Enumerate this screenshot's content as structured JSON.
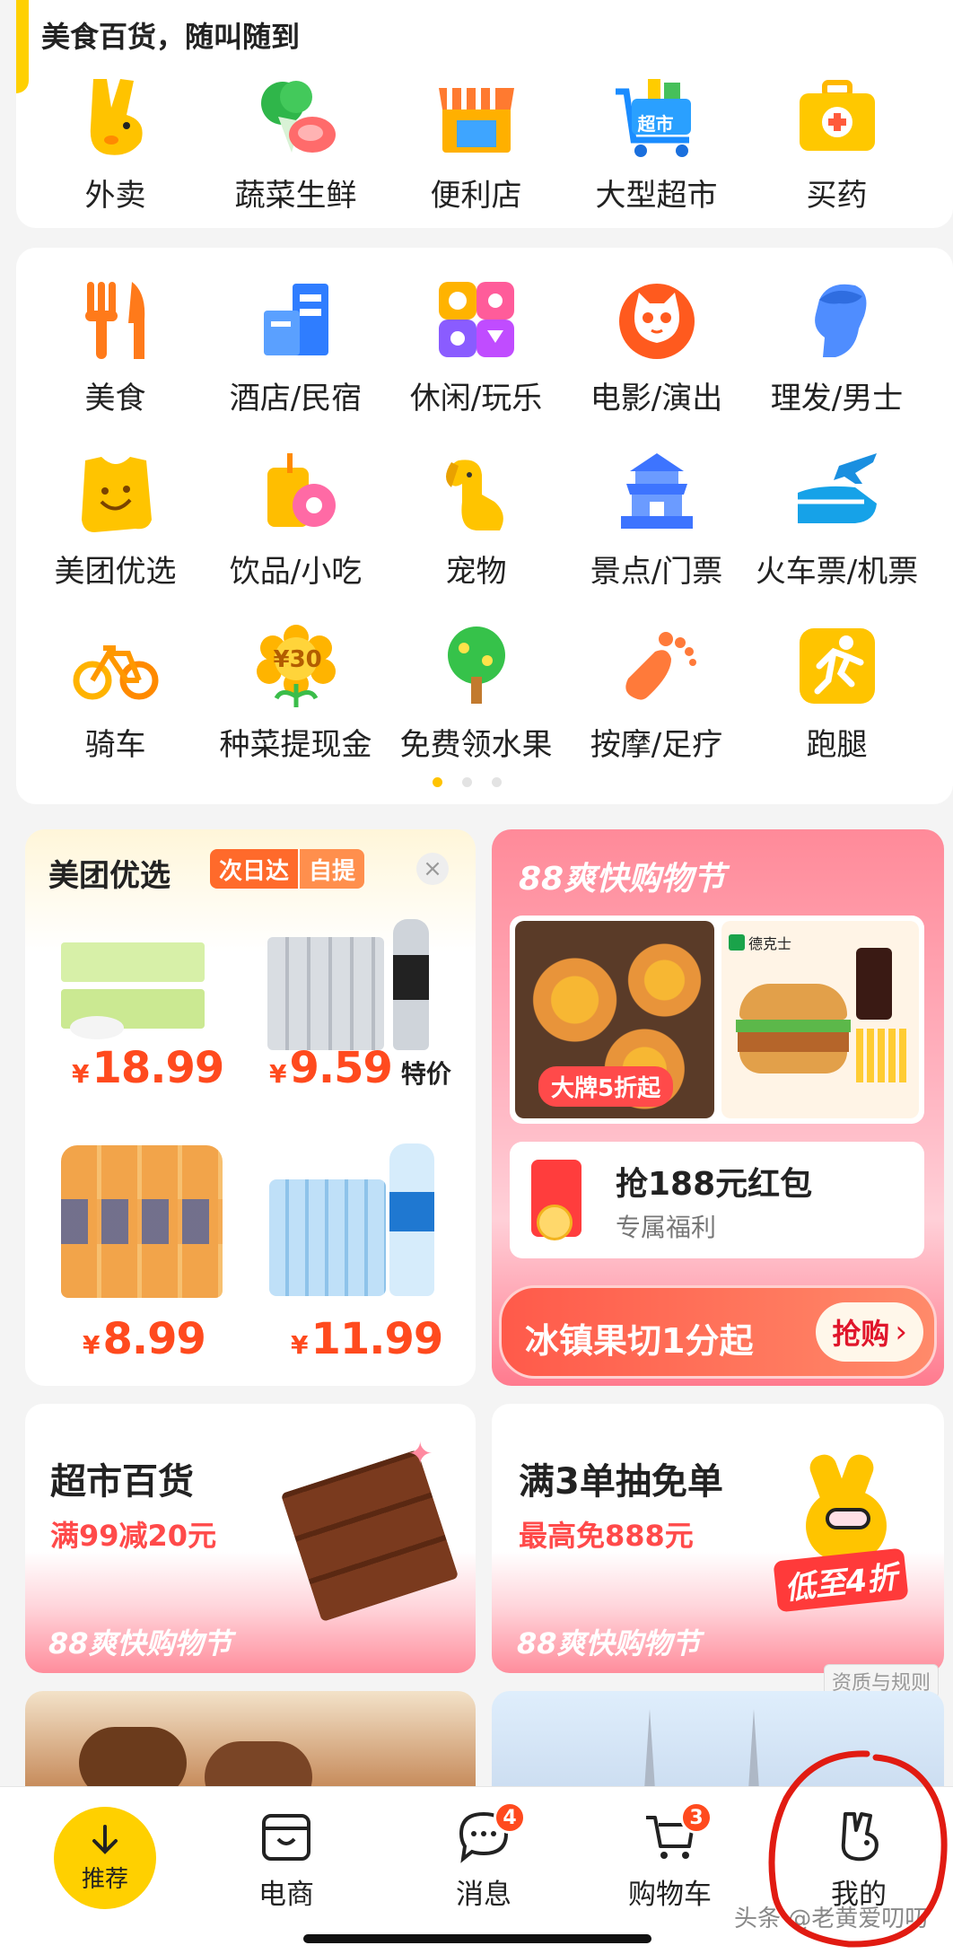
{
  "food_section": {
    "title": "美食百货，随叫随到",
    "items": [
      {
        "label": "外卖",
        "icon": "kangaroo-icon"
      },
      {
        "label": "蔬菜生鲜",
        "icon": "vegetable-meat-icon"
      },
      {
        "label": "便利店",
        "icon": "convenience-store-icon"
      },
      {
        "label": "大型超市",
        "icon": "supermarket-cart-icon"
      },
      {
        "label": "买药",
        "icon": "medicine-box-icon"
      }
    ]
  },
  "services": {
    "items": [
      {
        "label": "美食",
        "icon": "fork-knife-icon"
      },
      {
        "label": "酒店/民宿",
        "icon": "hotel-building-icon"
      },
      {
        "label": "休闲/玩乐",
        "icon": "leisure-icon"
      },
      {
        "label": "电影/演出",
        "icon": "cat-movie-icon"
      },
      {
        "label": "理发/男士",
        "icon": "haircut-head-icon"
      },
      {
        "label": "美团优选",
        "icon": "smile-bag-icon"
      },
      {
        "label": "饮品/小吃",
        "icon": "drink-donut-icon"
      },
      {
        "label": "宠物",
        "icon": "dog-icon"
      },
      {
        "label": "景点/门票",
        "icon": "temple-icon"
      },
      {
        "label": "火车票/机票",
        "icon": "train-plane-icon"
      },
      {
        "label": "骑车",
        "icon": "bicycle-icon"
      },
      {
        "label": "种菜提现金",
        "icon": "flower-cash-icon"
      },
      {
        "label": "免费领水果",
        "icon": "fruit-tree-icon"
      },
      {
        "label": "按摩/足疗",
        "icon": "foot-icon"
      },
      {
        "label": "跑腿",
        "icon": "runner-icon"
      }
    ],
    "flower_badge": "¥30",
    "supermarket_badge": "超市"
  },
  "youxuan": {
    "title": "美团优选",
    "tag1": "次日达",
    "tag2": "自提",
    "close": "×",
    "products": [
      {
        "price": "18.99",
        "currency": "¥",
        "extra": ""
      },
      {
        "price": "9.59",
        "currency": "¥",
        "extra": "特价"
      },
      {
        "price": "8.99",
        "currency": "¥",
        "extra": ""
      },
      {
        "price": "11.99",
        "currency": "¥",
        "extra": ""
      }
    ]
  },
  "festival": {
    "title": "88爽快购物节",
    "discount_tag": "大牌5折起",
    "brand": "德克士",
    "coupon_title": "抢188元红包",
    "coupon_sub": "专属福利",
    "bottom_text": "冰镇果切1分起",
    "buy_button": "抢购",
    "buy_arrow": "›"
  },
  "banners": [
    {
      "title": "超市百货",
      "subtitle": "满99减20元",
      "footer": "88爽快购物节"
    },
    {
      "title": "满3单抽免单",
      "subtitle": "最高免888元",
      "footer": "88爽快购物节",
      "stamp": "低至4折"
    }
  ],
  "rules_link": "资质与规则",
  "nav": {
    "items": [
      {
        "label": "推荐",
        "icon": "down-arrow-icon"
      },
      {
        "label": "电商",
        "icon": "shop-bag-icon"
      },
      {
        "label": "消息",
        "icon": "chat-bubble-icon",
        "badge": "4"
      },
      {
        "label": "购物车",
        "icon": "cart-icon",
        "badge": "3"
      },
      {
        "label": "我的",
        "icon": "kangaroo-outline-icon"
      }
    ]
  },
  "watermark": "头条 @老黄爱叨叨",
  "colors": {
    "brand_yellow": "#ffd000",
    "price_red": "#ff4a1e",
    "festival_pink": "#ff6b7d",
    "annotation_red": "#e11b12"
  }
}
